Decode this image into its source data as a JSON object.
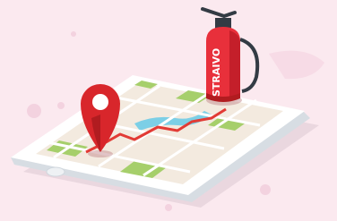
{
  "illustration": {
    "extinguisher_brand": "STRAIVO"
  },
  "colors": {
    "background": "#fbe9ef",
    "phone_body": "#ffffff",
    "phone_edge": "#d7dde3",
    "map_road": "#ffffff",
    "map_block": "#f3eadf",
    "map_park": "#a6cf6b",
    "map_water": "#7ccfe6",
    "route": "#e23b35",
    "pin": "#d8262b",
    "extinguisher": "#e8303b"
  }
}
